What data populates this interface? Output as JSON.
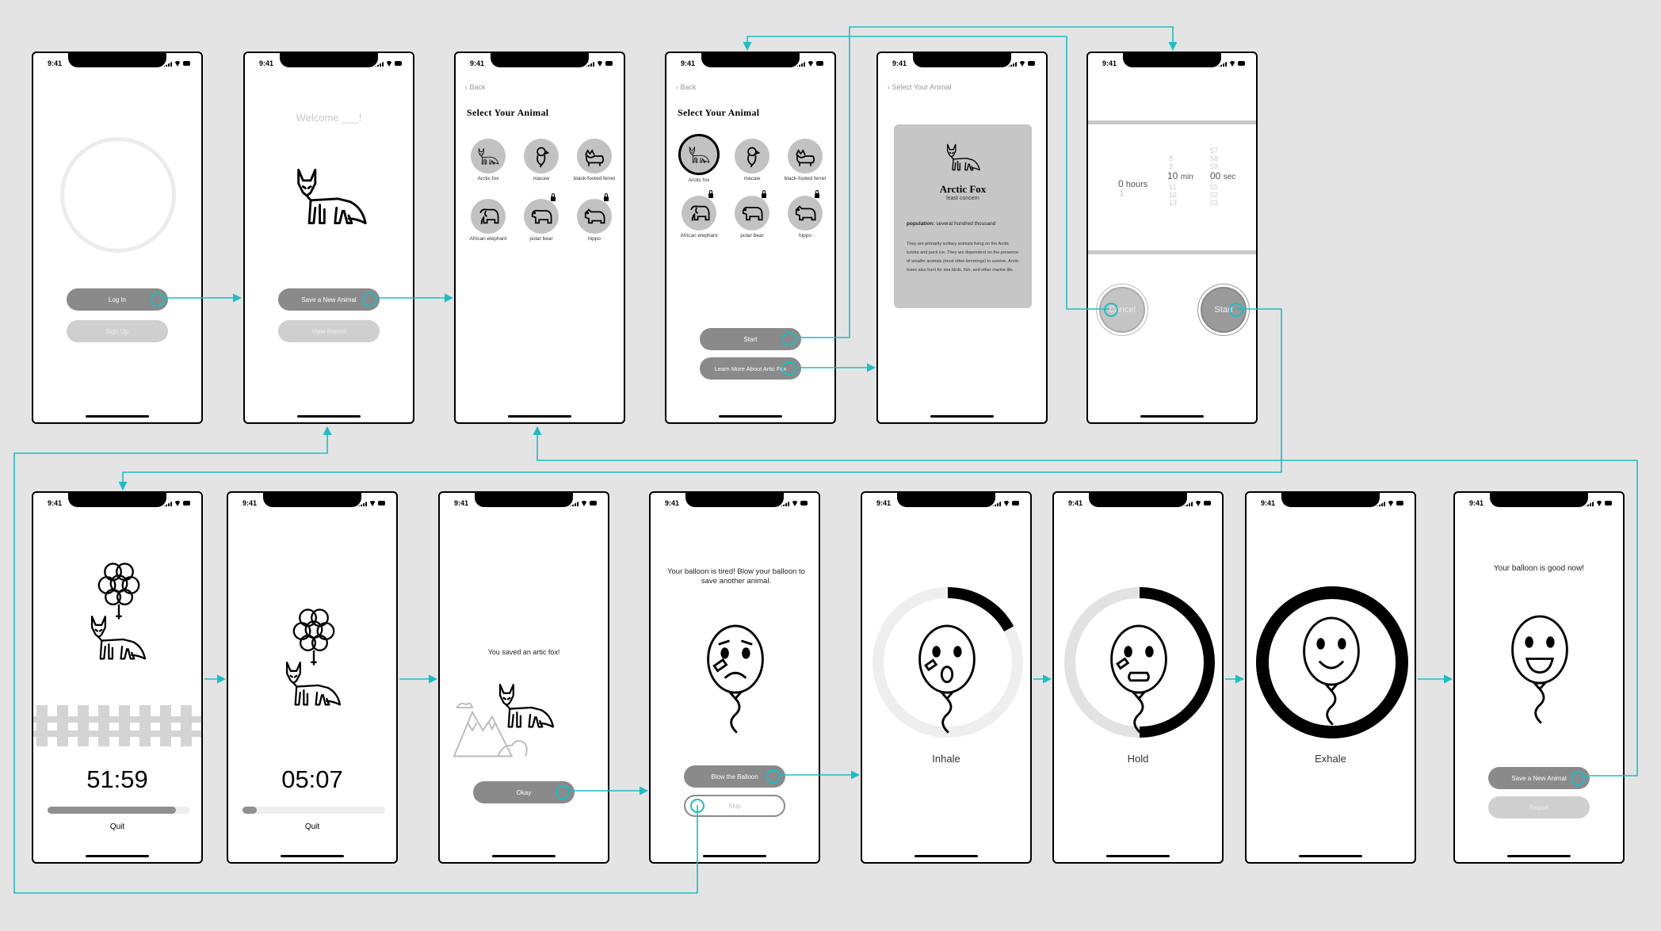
{
  "status_time": "9:41",
  "accent_color": "#1dbdc3",
  "login": {
    "login_label": "Log In",
    "signup_label": "Sign Up"
  },
  "welcome": {
    "greeting": "Welcome ___!",
    "save_label": "Save a New Animal",
    "report_label": "View Report"
  },
  "select": {
    "back_label": "Back",
    "title": "Select Your Animal",
    "animals": [
      {
        "name": "Arctic fox",
        "icon": "fox-icon",
        "locked": false
      },
      {
        "name": "macaw",
        "icon": "macaw-icon",
        "locked": false
      },
      {
        "name": "black-footed ferret",
        "icon": "ferret-icon",
        "locked": false
      },
      {
        "name": "African elephant",
        "icon": "elephant-icon",
        "locked": true
      },
      {
        "name": "polar bear",
        "icon": "polar-bear-icon",
        "locked": true
      },
      {
        "name": "hippo",
        "icon": "hippo-icon",
        "locked": true
      }
    ],
    "start_label": "Start",
    "learn_label": "Learn More About Artic Fox"
  },
  "info": {
    "back_label": "Select Your Animal",
    "name": "Arctic Fox",
    "status": "least concern",
    "population_label": "population:",
    "population_value": "several hundred thousand",
    "description": "They are primarily solitary animals living on the Arctic tundra and pack ice. They are dependent on the presence of smaller animals (most often lemmings) to survive.  Arctic foxes also hunt for sea birds, fish, and other marine life."
  },
  "picker": {
    "hours_value": "0",
    "hours_unit": "hours",
    "hours_below": "1",
    "min_above": [
      "8",
      "9"
    ],
    "min_value": "10",
    "min_unit": "min",
    "min_below": [
      "11",
      "12",
      "13"
    ],
    "sec_above": [
      "57",
      "58",
      "59"
    ],
    "sec_value": "00",
    "sec_unit": "sec",
    "sec_below": [
      "01",
      "02",
      "03"
    ],
    "cancel_label": "Cancel",
    "start_label": "Start"
  },
  "session1": {
    "timer": "51:59",
    "progress": 0.9,
    "quit_label": "Quit"
  },
  "session2": {
    "timer": "05:07",
    "progress": 0.1,
    "quit_label": "Quit"
  },
  "saved": {
    "message": "You saved an artic fox!",
    "okay_label": "Okay"
  },
  "tired": {
    "message": "Your balloon is tired!  Blow your balloon to save another animal.",
    "blow_label": "Blow the Balloon",
    "skip_label": "Skip"
  },
  "breath": {
    "inhale_label": "Inhale",
    "inhale_progress": 0.17,
    "hold_label": "Hold",
    "hold_progress": 0.5,
    "exhale_label": "Exhale",
    "exhale_progress": 1.0
  },
  "good": {
    "message": "Your balloon is good now!",
    "save_label": "Save a New Animal",
    "report_label": "Report"
  }
}
